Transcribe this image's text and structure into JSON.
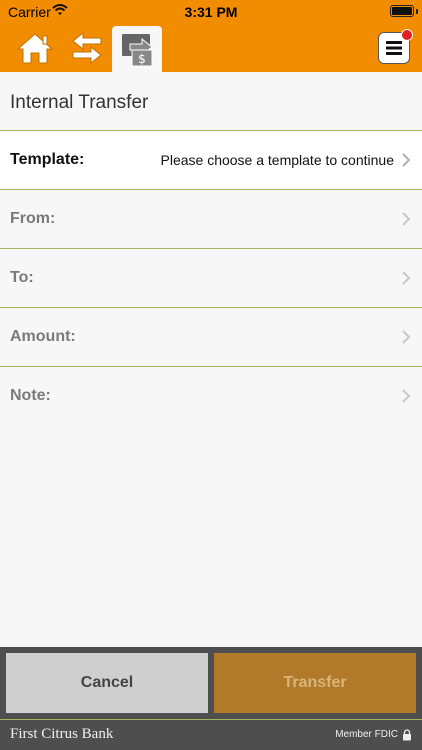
{
  "status_bar": {
    "carrier": "Carrier",
    "time": "3:31 PM"
  },
  "nav": {
    "icons": [
      "home-icon",
      "transfer-arrows-icon",
      "pay-bill-icon",
      "menu-icon"
    ],
    "menu_badge_color": "#e02020",
    "brand_color": "#f28c00"
  },
  "page": {
    "title": "Internal Transfer"
  },
  "form": {
    "template": {
      "label": "Template:",
      "value": "Please choose a template to continue"
    },
    "from": {
      "label": "From:",
      "value": ""
    },
    "to": {
      "label": "To:",
      "value": ""
    },
    "amount": {
      "label": "Amount:",
      "value": ""
    },
    "note": {
      "label": "Note:",
      "value": ""
    }
  },
  "actions": {
    "cancel_label": "Cancel",
    "transfer_label": "Transfer"
  },
  "footer": {
    "bank_name": "First Citrus Bank",
    "fdic": "Member FDIC"
  }
}
